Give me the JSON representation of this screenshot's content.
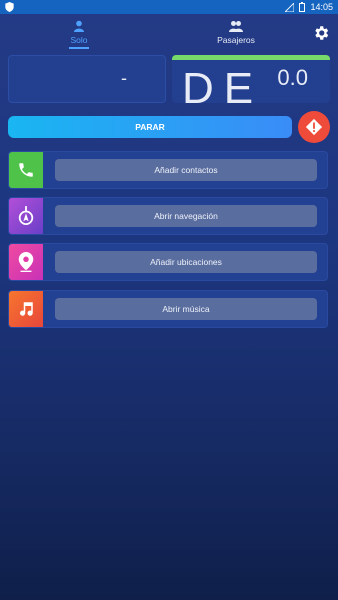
{
  "status_bar": {
    "time": "14:05",
    "shield_icon": "shield-icon",
    "signal_icon": "no-signal-icon",
    "battery_icon": "battery-icon"
  },
  "tabs": [
    {
      "label": "Solo",
      "icon": "person-icon",
      "active": true
    },
    {
      "label": "Pasajeros",
      "icon": "group-icon",
      "active": false
    }
  ],
  "settings_icon": "gear-icon",
  "panels": {
    "left_value": "-",
    "right_big": "DE",
    "right_value": "0.0",
    "right_accent": "#76d96a"
  },
  "parar_label": "PARAR",
  "alert_icon": "alert-icon",
  "cards": [
    {
      "label": "Añadir contactos",
      "icon": "phone-icon",
      "color": "#4fc24a"
    },
    {
      "label": "Abrir navegación",
      "icon": "compass-icon",
      "color": "#8a4bd1"
    },
    {
      "label": "Añadir ubicaciones",
      "icon": "location-pin-icon",
      "color": "#e33aa7"
    },
    {
      "label": "Abrir música",
      "icon": "music-note-icon",
      "color": "#f0582f"
    }
  ]
}
